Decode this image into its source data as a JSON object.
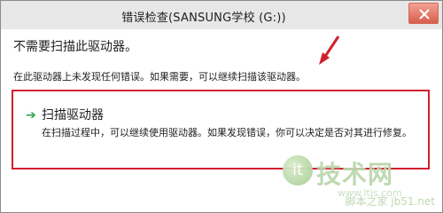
{
  "window": {
    "title": "错误检查(SANSUNG学校 (G:))"
  },
  "dialog": {
    "heading": "不需要扫描此驱动器。",
    "description": "在此驱动器上未发现任何错误。如果需要，可以继续扫描该驱动器。"
  },
  "scan_option": {
    "icon": "arrow-right-icon",
    "title": "扫描驱动器",
    "detail": "在扫描过程中，可以继续使用驱动器。如果发现错误，你可以决定是否对其进行修复。"
  },
  "watermark": {
    "logo": "jb51-logo",
    "text": "技术网",
    "url": "www.itis.com",
    "brand": "脚本之家 jb51.net"
  },
  "colors": {
    "accent_red": "#d2202f",
    "accent_green": "#2ea44f"
  }
}
